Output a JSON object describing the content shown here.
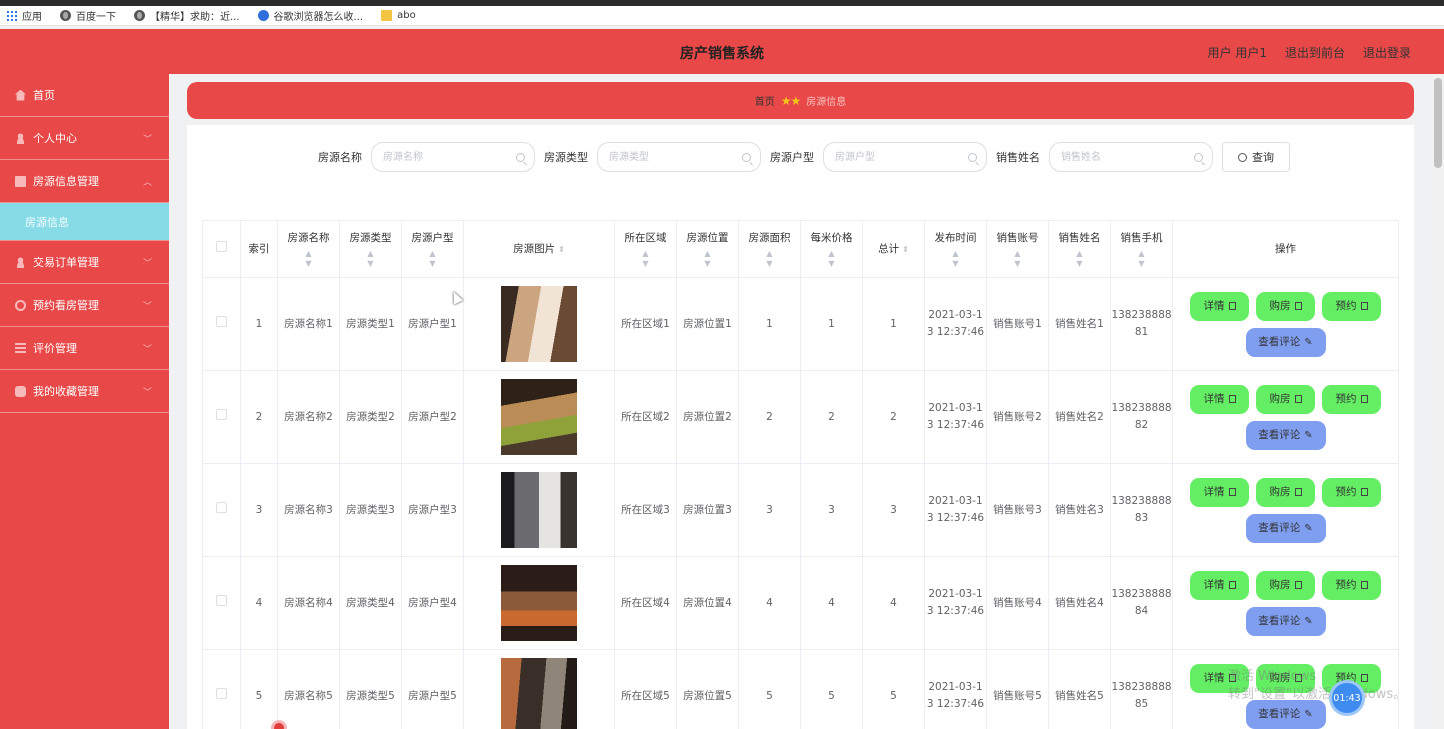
{
  "browser": {
    "bookmarks": [
      {
        "label": "应用",
        "icon": "apps-grid-icon"
      },
      {
        "label": "百度一下",
        "icon": "globe-icon"
      },
      {
        "label": "【精华】求助：近...",
        "icon": "globe-icon"
      },
      {
        "label": "谷歌浏览器怎么收...",
        "icon": "baidu-paw-icon"
      },
      {
        "label": "abo",
        "icon": "folder-icon"
      }
    ]
  },
  "header": {
    "title": "房产销售系统",
    "user_label": "用户 用户1",
    "back_label": "退出到前台",
    "logout_label": "退出登录",
    "color": "#e84848"
  },
  "sidebar": {
    "items": [
      {
        "label": "首页",
        "icon": "home-icon"
      },
      {
        "label": "个人中心",
        "icon": "user-icon"
      },
      {
        "label": "房源信息管理",
        "icon": "box-icon",
        "expanded": true
      },
      {
        "label": "房源信息",
        "sub": true,
        "active": true
      },
      {
        "label": "交易订单管理",
        "icon": "user-icon"
      },
      {
        "label": "预约看房管理",
        "icon": "power-icon"
      },
      {
        "label": "评价管理",
        "icon": "list-icon"
      },
      {
        "label": "我的收藏管理",
        "icon": "database-icon"
      }
    ]
  },
  "breadcrumb": {
    "home": "首页",
    "separator": "★★",
    "current": "房源信息"
  },
  "search": {
    "fields": [
      {
        "label": "房源名称",
        "placeholder": "房源名称"
      },
      {
        "label": "房源类型",
        "placeholder": "房源类型"
      },
      {
        "label": "房源户型",
        "placeholder": "房源户型"
      },
      {
        "label": "销售姓名",
        "placeholder": "销售姓名"
      }
    ],
    "button_label": "查询"
  },
  "table": {
    "headers": [
      "索引",
      "房源名称",
      "房源类型",
      "房源户型",
      "房源图片",
      "所在区域",
      "房源位置",
      "房源面积",
      "每米价格",
      "总计",
      "发布时间",
      "销售账号",
      "销售姓名",
      "销售手机",
      "操作"
    ],
    "rows": [
      {
        "index": "1",
        "name": "房源名称1",
        "type": "房源类型1",
        "layout": "房源户型1",
        "area": "所在区域1",
        "location": "房源位置1",
        "size": "1",
        "price": "1",
        "total": "1",
        "time": "2021-03-13 12:37:46",
        "account": "销售账号1",
        "seller": "销售姓名1",
        "phone": "13823888881",
        "photo": "bedroom-photo"
      },
      {
        "index": "2",
        "name": "房源名称2",
        "type": "房源类型2",
        "layout": "房源户型2",
        "area": "所在区域2",
        "location": "房源位置2",
        "size": "2",
        "price": "2",
        "total": "2",
        "time": "2021-03-13 12:37:46",
        "account": "销售账号2",
        "seller": "销售姓名2",
        "phone": "13823888882",
        "photo": "living-room-photo"
      },
      {
        "index": "3",
        "name": "房源名称3",
        "type": "房源类型3",
        "layout": "房源户型3",
        "area": "所在区域3",
        "location": "房源位置3",
        "size": "3",
        "price": "3",
        "total": "3",
        "time": "2021-03-13 12:37:46",
        "account": "销售账号3",
        "seller": "销售姓名3",
        "phone": "13823888883",
        "photo": "bedroom-photo"
      },
      {
        "index": "4",
        "name": "房源名称4",
        "type": "房源类型4",
        "layout": "房源户型4",
        "area": "所在区域4",
        "location": "房源位置4",
        "size": "4",
        "price": "4",
        "total": "4",
        "time": "2021-03-13 12:37:46",
        "account": "销售账号4",
        "seller": "销售姓名4",
        "phone": "13823888884",
        "photo": "bedroom-photo"
      },
      {
        "index": "5",
        "name": "房源名称5",
        "type": "房源类型5",
        "layout": "房源户型5",
        "area": "所在区域5",
        "location": "房源位置5",
        "size": "5",
        "price": "5",
        "total": "5",
        "time": "2021-03-13 12:37:46",
        "account": "销售账号5",
        "seller": "销售姓名5",
        "phone": "13823888885",
        "photo": "interior-photo"
      }
    ],
    "actions": {
      "detail": "详情",
      "buy": "购房",
      "reserve": "预约",
      "comments": "查看评论",
      "green": "#63ee63",
      "blue": "#7f9ef0"
    }
  },
  "overlay": {
    "timer": "01:43",
    "watermark_line1": "激活 Windows",
    "watermark_line2": "转到\"设置\"以激活 Windows。"
  }
}
